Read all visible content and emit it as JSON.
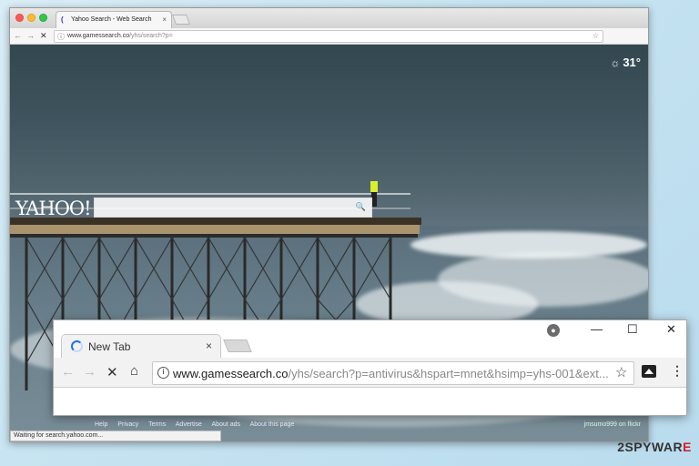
{
  "back_browser": {
    "tab_title": "Yahoo Search - Web Search",
    "tab_close": "×",
    "url_domain": "www.gamessearch.co",
    "url_path": "/yhs/search?p=",
    "weather_temp": "31°",
    "logo": "YAHOO!",
    "footer_links": [
      "Help",
      "Privacy",
      "Terms",
      "Advertise",
      "About ads",
      "About this page"
    ],
    "photo_credit": "jmsumo999 on flickr",
    "status_text": "Waiting for search.yahoo.com..."
  },
  "front_browser": {
    "tab_title": "New Tab",
    "tab_close": "×",
    "url_domain": "www.gamessearch.co",
    "url_path": "/yhs/search?p=antivirus&hspart=mnet&hsimp=yhs-001&ext..."
  },
  "watermark": {
    "main": "2SPYWAR",
    "accent": "E"
  },
  "icons": {
    "back": "←",
    "forward": "→",
    "stop": "✕",
    "home": "⌂",
    "star": "☆",
    "menu": "⋮",
    "minimize": "—",
    "maximize": "☐",
    "close": "✕",
    "info": "i",
    "search": "🔍",
    "weather": "☼"
  }
}
